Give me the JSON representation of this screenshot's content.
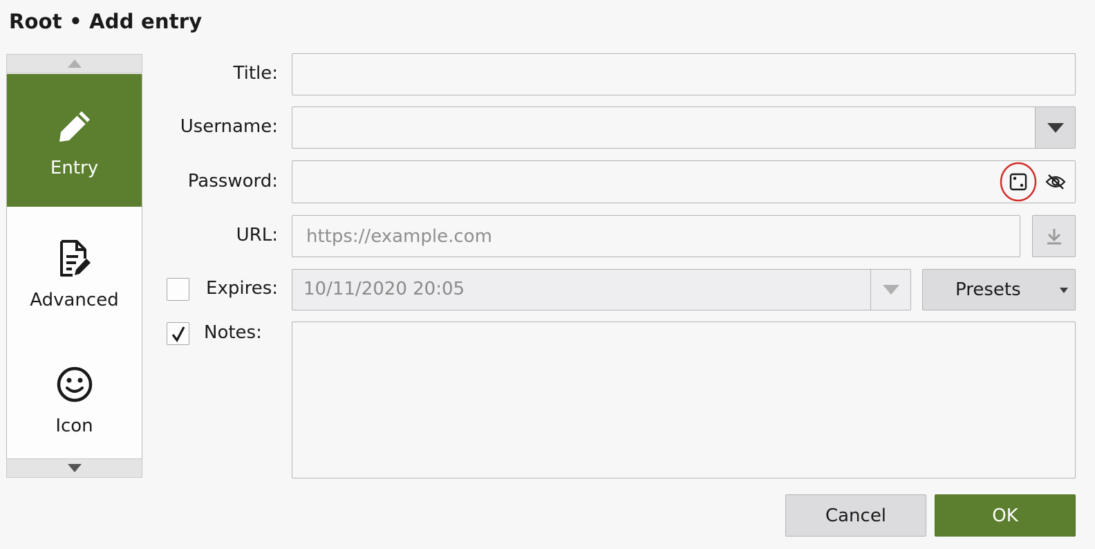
{
  "dialog": {
    "title": "Root • Add entry"
  },
  "sidebar": {
    "items": [
      {
        "label": "Entry",
        "icon": "pencil-icon",
        "active": true
      },
      {
        "label": "Advanced",
        "icon": "document-edit-icon",
        "active": false
      },
      {
        "label": "Icon",
        "icon": "smiley-icon",
        "active": false
      }
    ]
  },
  "form": {
    "title": {
      "label": "Title:",
      "value": ""
    },
    "username": {
      "label": "Username:",
      "value": ""
    },
    "password": {
      "label": "Password:",
      "value": ""
    },
    "url": {
      "label": "URL:",
      "value": "",
      "placeholder": "https://example.com"
    },
    "expires": {
      "label": "Expires:",
      "checked": false,
      "value": "10/11/2020 20:05",
      "presets_label": "Presets"
    },
    "notes": {
      "label": "Notes:",
      "checked": true,
      "value": ""
    }
  },
  "buttons": {
    "cancel": "Cancel",
    "ok": "OK"
  },
  "colors": {
    "accent": "#5b7f2e",
    "highlight_ring": "#d42b2b"
  }
}
